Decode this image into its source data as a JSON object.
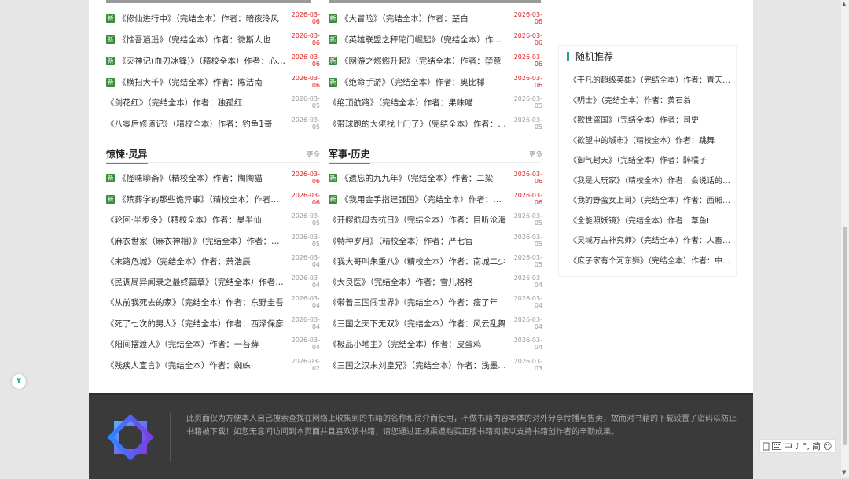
{
  "new_badge": "新",
  "more_label": "更多",
  "top_left": [
    {
      "new": true,
      "title": "《修仙进行中》（完结全本）作者：暗夜泠风",
      "date": "2026-03-06",
      "red": true
    },
    {
      "new": true,
      "title": "《惟吾逍遥》（完结全本）作者：微斯人也",
      "date": "2026-03-06",
      "red": true
    },
    {
      "new": true,
      "title": "《灭神记(血刃冰锋)》（精校全本）作者：心梦无痕",
      "date": "2026-03-06",
      "red": true
    },
    {
      "new": true,
      "title": "《横扫大千》（完结全本）作者：陈洁南",
      "date": "2026-03-06",
      "red": true
    },
    {
      "new": false,
      "title": "《剑花红》（完结全本）作者：独孤红",
      "date": "2026-03-05",
      "red": false
    },
    {
      "new": false,
      "title": "《八零后修道记》（精校全本）作者：钓鱼1哥",
      "date": "2026-03-05",
      "red": false
    }
  ],
  "top_right": [
    {
      "new": true,
      "title": "《大冒险》（完结全本）作者：楚白",
      "date": "2026-03-06",
      "red": true
    },
    {
      "new": true,
      "title": "《英雄联盟之秤砣门崛起》（完结全本）作者：铁头娃",
      "date": "2026-03-06",
      "red": true
    },
    {
      "new": true,
      "title": "《网游之燃燃升起》（完结全本）作者：禁意",
      "date": "2026-03-06",
      "red": true
    },
    {
      "new": true,
      "title": "《绝命手游》（完结全本）作者：奥比椰",
      "date": "2026-03-06",
      "red": true
    },
    {
      "new": false,
      "title": "《绝顶航路》（完结全本）作者：果味喵",
      "date": "2026-03-05",
      "red": false
    },
    {
      "new": false,
      "title": "《带球跑的大佬找上门了》（完结全本）作者：小小",
      "date": "2026-03-05",
      "red": false
    }
  ],
  "sections": [
    {
      "title": "惊悚·灵异",
      "items": [
        {
          "new": true,
          "title": "《怪味聊斋》（精校全本）作者：陶陶猫",
          "date": "2026-03-06",
          "red": true
        },
        {
          "new": true,
          "title": "《殡葬学的那些诡异事》（精校全本）作者：张三",
          "date": "2026-03-06",
          "red": true
        },
        {
          "new": false,
          "title": "《轮回·半步多》（精校全本）作者：昊半仙",
          "date": "2026-03-05",
          "red": false
        },
        {
          "new": false,
          "title": "《麻衣世家（麻衣神相）》（完结全本）作者：小樱",
          "date": "2026-03-05",
          "red": false
        },
        {
          "new": false,
          "title": "《末路危城》（完结全本）作者：萧浩辰",
          "date": "2026-03-04",
          "red": false
        },
        {
          "new": false,
          "title": "《民调局异闻录之最终篇章》（完结全本）作者：耳东水寿",
          "date": "2026-03-04",
          "red": false
        },
        {
          "new": false,
          "title": "《从前我死去的家》（完结全本）作者：东野圭吾",
          "date": "2026-03-04",
          "red": false
        },
        {
          "new": false,
          "title": "《死了七次的男人》（完结全本）作者：西泽保彦",
          "date": "2026-03-04",
          "red": false
        },
        {
          "new": false,
          "title": "《阳间摆渡人》（完结全本）作者：一苔藓",
          "date": "2026-03-04",
          "red": false
        },
        {
          "new": false,
          "title": "《残疾人宣言》（完结全本）作者：蜘蛛",
          "date": "2026-03-02",
          "red": false
        }
      ]
    },
    {
      "title": "军事·历史",
      "items": [
        {
          "new": true,
          "title": "《遗忘的九九年》（完结全本）作者：二梁",
          "date": "2026-03-06",
          "red": true
        },
        {
          "new": true,
          "title": "《我用金手指建强国》（完结全本）作者：我也",
          "date": "2026-03-06",
          "red": true
        },
        {
          "new": false,
          "title": "《开艘航母去抗日》（完结全本）作者：目听沧海",
          "date": "2026-03-05",
          "red": false
        },
        {
          "new": false,
          "title": "《特种岁月》（精校全本）作者：严七官",
          "date": "2026-03-05",
          "red": false
        },
        {
          "new": false,
          "title": "《我大哥叫朱重八》（精校全本）作者：南城二少",
          "date": "2026-03-05",
          "red": false
        },
        {
          "new": false,
          "title": "《大良医》（完结全本）作者：雪儿格格",
          "date": "2026-03-04",
          "red": false
        },
        {
          "new": false,
          "title": "《带着三国闯世界》（完结全本）作者：瘦了年",
          "date": "2026-03-04",
          "red": false
        },
        {
          "new": false,
          "title": "《三国之天下无双》（完结全本）作者：风云乱舞",
          "date": "2026-03-04",
          "red": false
        },
        {
          "new": false,
          "title": "《极品小地主》（完结全本）作者：皮蛋鸡",
          "date": "2026-03-04",
          "red": false
        },
        {
          "new": false,
          "title": "《三国之汉末刘皇兄》（完结全本）作者：浅墨浓妆",
          "date": "2026-03-03",
          "red": false
        }
      ]
    }
  ],
  "sidebar": {
    "title": "随机推荐",
    "items": [
      "《平凡的超级英雄》（完结全本）作者：青天大老爷",
      "《明士》（完结全本）作者：黄石翁",
      "《欺世盗国》（完结全本）作者：司史",
      "《欲望中的城市》（精校全本）作者：跳舞",
      "《御气封天》（完结全本）作者：醉橘子",
      "《我是大玩家》（精校全本）作者：会说话的肘子",
      "《我的野蛮女上司》（完结全本）作者：西厢少爷",
      "《全能照妖镜》（完结全本）作者：草鱼L",
      "《灵域万古神究师》（完结全本）作者：人畜无害",
      "《庶子家有个河东狮》（完结全本）作者：中二病"
    ]
  },
  "footer": {
    "text": "此页面仅为方便本人自己搜索查找在网络上收集到的书籍的名称和简介而使用，不做书籍内容本体的对外分享传播与售卖，故而对书籍的下载设置了密码以防止书籍被下载！如您无意间访问到本页面并且喜欢该书籍，请您通过正规渠道购买正版书籍阅读以支持书籍创作者的辛勤成果。"
  },
  "ime": {
    "items": [
      "中",
      "♪",
      "°,",
      "简",
      "☺"
    ]
  },
  "badge": "Y",
  "colors": {
    "accent": "#2e9aa6",
    "new_green": "#3a8c3a",
    "red_date": "#e02020",
    "footer_bg": "#3a3a3a"
  }
}
